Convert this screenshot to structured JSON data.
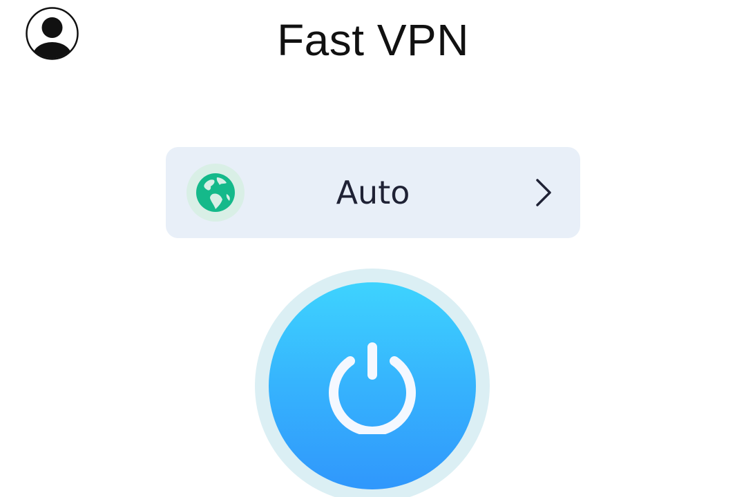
{
  "header": {
    "title": "Fast VPN",
    "profile_icon": "user-circle-icon"
  },
  "server_selector": {
    "location": "Auto",
    "flag_icon": "globe-icon",
    "arrow_icon": "chevron-right-icon"
  },
  "connect": {
    "icon": "power-icon"
  },
  "colors": {
    "background": "#ffffff",
    "title_text": "#111111",
    "selector_background": "#e8eff8",
    "selector_text": "#1f2235",
    "globe_green": "#15b98a",
    "globe_halo": "#d9efe6",
    "power_gradient_top": "#3ed3fe",
    "power_gradient_bottom": "#3097fc",
    "power_halo": "#dbeff4"
  }
}
